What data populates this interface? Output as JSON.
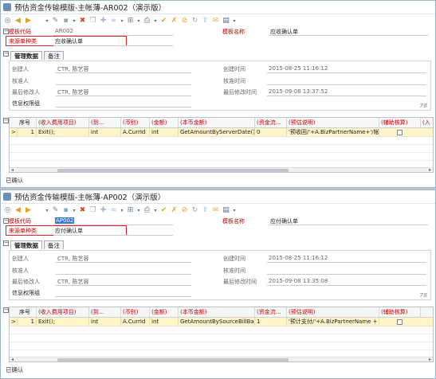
{
  "windows": [
    {
      "title": "预估资金传输模版-主帐薄-AR002（演示版）",
      "toolbar_icons": [
        "search-icon",
        "back-arrow-icon",
        "forward-arrow-icon",
        "new-document-icon",
        "dropdown-icon",
        "edit-icon",
        "save-icon",
        "dropdown-icon",
        "delete-icon",
        "copy-icon",
        "attach-icon",
        "link-icon",
        "dropdown-icon",
        "expand-icon",
        "dropdown-icon",
        "print-icon",
        "dropdown-icon",
        "audit-icon",
        "unaudit-icon",
        "close-audit-icon",
        "refresh-icon",
        "export-icon",
        "mail-icon",
        "report-icon",
        "dropdown-icon"
      ],
      "template_code_label": "模板代码",
      "template_code_value": "AR002",
      "template_code_selected": false,
      "template_name_label": "模板名称",
      "template_name_value": "应收确认单",
      "source_type_label": "来源单种类",
      "source_type_value": "应收确认单",
      "tab_manage": "管理数据",
      "tab_remark": "备注",
      "creator_label": "创建人",
      "creator_value": "CTR, 陈艺蓉",
      "create_time_label": "创建时间",
      "create_time_value": "2015-08-25 11:16:12",
      "auditor_label": "核准人",
      "audit_time_label": "核准时间",
      "last_modifier_label": "最后修改人",
      "last_modifier_value": "CTR, 陈艺蓉",
      "last_modified_label": "最后修改时间",
      "last_modified_value": "2015-09-08 13:37:52",
      "permission_group_label": "信息权限组",
      "badge": "78",
      "grid": {
        "headers": [
          "序号",
          "(收入费用项目)",
          "(到...",
          "(币别)",
          "(金额)",
          "(本币金额)",
          "(资金流...",
          "(预估说明)",
          "(辅助核算)",
          "(入"
        ],
        "row": [
          ">",
          "1",
          "Exit();",
          "int",
          "A.CurrId",
          "int",
          "GetAmountByServerDate()",
          "0",
          "'预收回/'+A.BizPartnerName+'/帐款'",
          ""
        ]
      },
      "status": "已确认"
    },
    {
      "title": "预估资金传输模版-主帐薄-AP002（演示版）",
      "toolbar_icons": [
        "search-icon",
        "back-arrow-icon",
        "forward-arrow-icon",
        "new-document-icon",
        "dropdown-icon",
        "edit-icon",
        "save-icon",
        "dropdown-icon",
        "delete-icon",
        "copy-icon",
        "attach-icon",
        "link-icon",
        "dropdown-icon",
        "expand-icon",
        "dropdown-icon",
        "print-icon",
        "dropdown-icon",
        "audit-icon",
        "unaudit-icon",
        "close-audit-icon",
        "refresh-icon",
        "export-icon",
        "mail-icon",
        "report-icon",
        "dropdown-icon"
      ],
      "template_code_label": "模板代码",
      "template_code_value": "AP002",
      "template_code_selected": true,
      "template_name_label": "模板名称",
      "template_name_value": "应付确认单",
      "source_type_label": "来源单种类",
      "source_type_value": "应付确认单",
      "tab_manage": "管理数据",
      "tab_remark": "备注",
      "creator_label": "创建人",
      "creator_value": "CTR, 陈艺蓉",
      "create_time_label": "创建时间",
      "create_time_value": "2015-08-25 11:16:12",
      "auditor_label": "核准人",
      "audit_time_label": "核准时间",
      "last_modifier_label": "最后修改人",
      "last_modifier_value": "CTR, 陈艺蓉",
      "last_modified_label": "最后修改时间",
      "last_modified_value": "2015-09-08 13:35:08",
      "permission_group_label": "信息权限组",
      "badge": "78",
      "grid": {
        "headers": [
          "序号",
          "(收入费用项目)",
          "(到...",
          "(币别)",
          "(金额)",
          "(本币金额)",
          "(资金流...",
          "(预估说明)",
          "(辅助核算)",
          ""
        ],
        "row": [
          ">",
          "1",
          "Exit();",
          "int",
          "A.CurrId",
          "int",
          "GetAmountBySourceBillBa",
          "1",
          "'预计支付/'+A.BizPartnerName +",
          ""
        ]
      },
      "status": "已确认"
    }
  ],
  "colors": {
    "highlight_row": "#fff5c8",
    "red_label": "#c00000",
    "red_box": "#e0222a",
    "selection": "#3a79d0"
  }
}
